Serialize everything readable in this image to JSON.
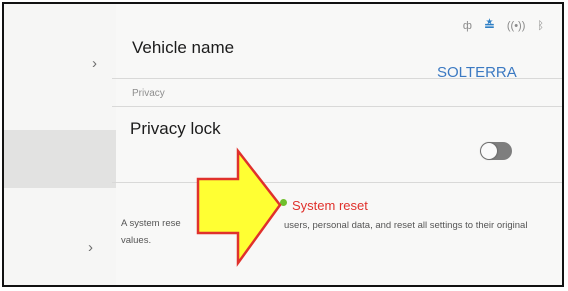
{
  "sidebar": {
    "items": [
      {
        "chevron": "›"
      },
      {
        "chevron": "›"
      }
    ]
  },
  "status_icons": [
    "antenna-icon",
    "connection-icon",
    "wireless-icon",
    "bluetooth-icon"
  ],
  "settings": {
    "vehicle_name_label": "Vehicle name",
    "vehicle_name_value": "SOLTERRA",
    "privacy_section": "Privacy",
    "privacy_lock_label": "Privacy lock",
    "privacy_lock_on": false,
    "system_reset_label": "System reset",
    "description_part1": "A system rese",
    "description_part2": "users, personal data, and reset all settings to their original",
    "description_part3": "values."
  },
  "annotation": {
    "arrow_color": "#ffff33",
    "arrow_border": "#e0312c"
  },
  "colors": {
    "accent": "#3b79c2",
    "reset_text": "#e0312c",
    "reset_dot": "#6fbf2c"
  }
}
